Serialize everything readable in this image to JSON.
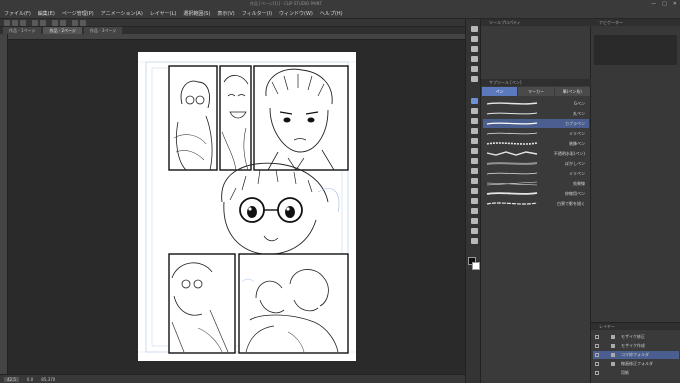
{
  "window": {
    "title": "作品 [ページ(1)] - CLIP STUDIO PAINT",
    "buttons": [
      "—",
      "□",
      "✕"
    ]
  },
  "menu": [
    "ファイル(F)",
    "編集(E)",
    "ページ管理(P)",
    "アニメーション(A)",
    "レイヤー(L)",
    "選択範囲(S)",
    "表示(V)",
    "フィルター(I)",
    "ウィンドウ(W)",
    "ヘルプ(H)"
  ],
  "tabs": [
    {
      "label": "作品 - 1ページ",
      "active": false
    },
    {
      "label": "作品 - 2ページ",
      "active": true
    },
    {
      "label": "作品 - 3ページ",
      "active": false
    }
  ],
  "status": {
    "zoom": "42.5",
    "angle": "0.0",
    "coords": "85,370"
  },
  "subtool": {
    "header": "サブツール [ペン]",
    "tabs": [
      "ペン",
      "マーカー",
      "筆(ペン系)"
    ],
    "brushes": [
      {
        "name": "Gペン",
        "selected": false
      },
      {
        "name": "丸ペン",
        "selected": false
      },
      {
        "name": "カブラペン",
        "selected": true
      },
      {
        "name": "ミリペン",
        "selected": false
      },
      {
        "name": "装飾ペン",
        "selected": false
      },
      {
        "name": "不透明水彩(ペン)",
        "selected": false
      },
      {
        "name": "ぼかしペン",
        "selected": false
      },
      {
        "name": "ミリペン",
        "selected": false
      },
      {
        "name": "効果線",
        "selected": false
      },
      {
        "name": "枠線用ペン",
        "selected": false
      },
      {
        "name": "白黒で影を描く",
        "selected": false
      }
    ]
  },
  "property_header": "ツールプロパティ",
  "navigator_header": "ナビゲーター",
  "layers": {
    "header": "レイヤー",
    "items": [
      {
        "name": "モザイク修正",
        "selected": false
      },
      {
        "name": "モザイク作成",
        "selected": false
      },
      {
        "name": "コマ枠フォルダ",
        "selected": true
      },
      {
        "name": "線画修正フォルダ",
        "selected": false
      },
      {
        "name": "用紙",
        "selected": false
      }
    ]
  },
  "colors": {
    "accent": "#5b79bd",
    "panel": "#3a3a3a",
    "canvas_bg": "#2a2a2a",
    "page": "#ffffff"
  }
}
